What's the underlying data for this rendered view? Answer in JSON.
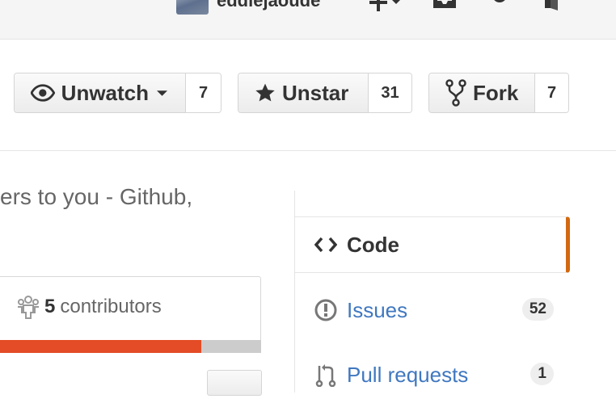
{
  "header": {
    "username": "eddiejaoude",
    "icons": [
      "avatar",
      "plus-icon",
      "chevron-down-icon",
      "inbox-icon",
      "gear-icon",
      "sign-out-icon"
    ]
  },
  "actions": {
    "watch": {
      "label": "Unwatch",
      "count": "7",
      "icon": "eye-icon"
    },
    "star": {
      "label": "Unstar",
      "count": "31",
      "icon": "star-icon"
    },
    "fork": {
      "label": "Fork",
      "count": "7",
      "icon": "fork-icon"
    }
  },
  "repo": {
    "description_partial": "ers to you - Github,"
  },
  "summary": {
    "contributors_count": "5",
    "contributors_label": "contributors",
    "languages": [
      {
        "color": "#2b7489",
        "fraction": 0.012
      },
      {
        "color": "#e34c26",
        "fraction": 0.765
      },
      {
        "color": "#cccccc",
        "fraction": 0.223
      }
    ]
  },
  "sidebar": {
    "code": {
      "label": "Code",
      "icon": "code-icon"
    },
    "issues": {
      "label": "Issues",
      "count": "52",
      "icon": "issue-opened-icon"
    },
    "pulls": {
      "label": "Pull requests",
      "count": "1",
      "icon": "git-pull-request-icon"
    }
  },
  "colors": {
    "accent": "#d26911",
    "link": "#4078c0"
  }
}
